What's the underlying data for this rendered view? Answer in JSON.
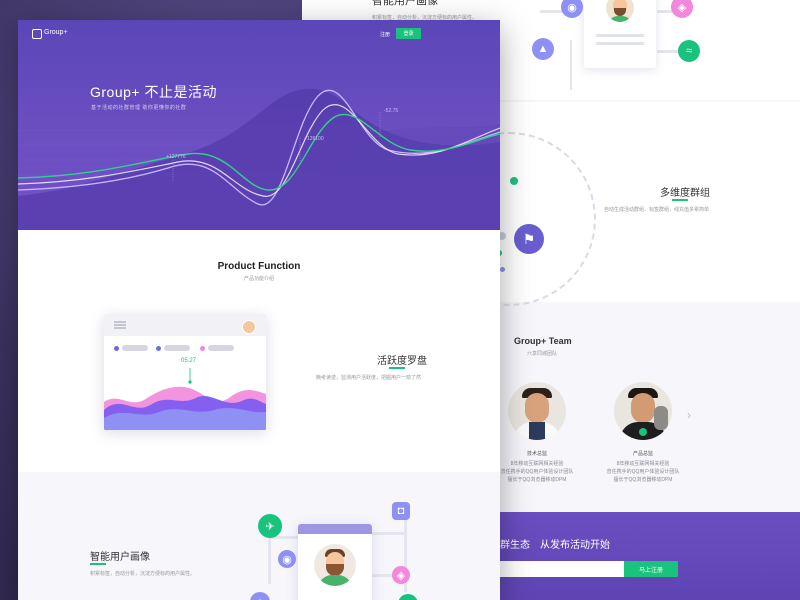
{
  "back_page": {
    "section_persona_title": "智能用户画像",
    "section_persona_desc": "积累标签，自动分析，沉淀方便标的用户属性。",
    "section_groups": {
      "title": "多维度群组",
      "desc": "自动生成活动群组、标签群组，线充值多累简单"
    },
    "team": {
      "title": "Group+ Team",
      "subtitle": "六享同城团队",
      "members": [
        {
          "role": "技术总监",
          "lines": [
            "8年移动互联网相关经验",
            "曾任携手的QQ用户体验设计团队",
            "擅长于QQ浏览器移动DPM"
          ]
        },
        {
          "role": "产品总监",
          "lines": [
            "8年移动互联网相关经验",
            "曾任携手的QQ用户体验设计团队",
            "擅长于QQ浏览器移动DPM"
          ]
        }
      ],
      "next_arrow": "›"
    },
    "cta": {
      "text_left": "群生态",
      "text_right": "从发布活动开始",
      "button": "马上注册"
    }
  },
  "front_page": {
    "nav": {
      "logo_text": "Group+",
      "login": "注册",
      "register": "登录"
    },
    "hero": {
      "title": "Group+  不止是活动",
      "subtitle": "基于活动的社群管理   助你更懂你的社群",
      "annotations": [
        "+127776",
        "+126100",
        "-52.75"
      ]
    },
    "product": {
      "title": "Product Function",
      "subtitle": "产品功能介绍",
      "feature_title": "活跃度罗盘",
      "feature_desc": "簡考读迹，监测用户活跃度，把握用户一箭了然",
      "chart_value": "05.27"
    },
    "persona": {
      "title": "智能用户画像",
      "desc": "积累标签，自动分析，沉淀方便标的用户属性。"
    }
  },
  "colors": {
    "brand_purple": "#6a4fc2",
    "green": "#19c37d",
    "pink": "#f288dc",
    "violet": "#7d5cf0",
    "periwinkle": "#8e90f3"
  }
}
